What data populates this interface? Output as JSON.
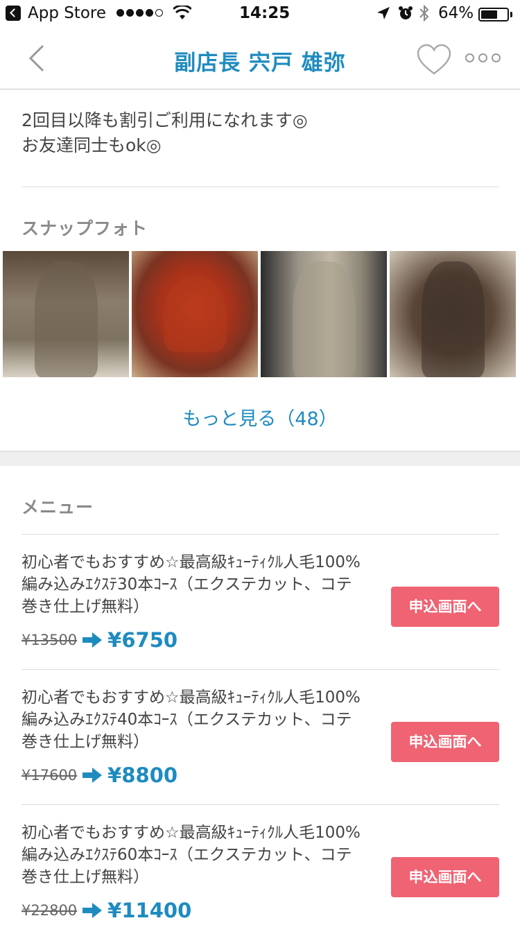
{
  "status_bar": {
    "back_app": "App Store",
    "time": "14:25",
    "battery": "64%",
    "battery_level": 0.64
  },
  "nav": {
    "title": "副店長 宍戸 雄弥"
  },
  "description": {
    "line1": "2回目以降も割引ご利用になれます◎",
    "line2": "お友達同士もok◎"
  },
  "snaps": {
    "heading": "スナップフォト",
    "more_label": "もっと見る（48）"
  },
  "menu": {
    "heading": "メニュー",
    "items": [
      {
        "line1": "初心者でもおすすめ☆最高級ｷｭｰﾃｨｸﾙ人毛100%",
        "line2": "編み込みｴｸｽﾃ30本ｺｰｽ（エクステカット、コテ",
        "line3": "巻き仕上げ無料）",
        "price_old": "¥13500",
        "price_new": "¥6750",
        "button": "申込画面へ"
      },
      {
        "line1": "初心者でもおすすめ☆最高級ｷｭｰﾃｨｸﾙ人毛100%",
        "line2": "編み込みｴｸｽﾃ40本ｺｰｽ（エクステカット、コテ",
        "line3": "巻き仕上げ無料）",
        "price_old": "¥17600",
        "price_new": "¥8800",
        "button": "申込画面へ"
      },
      {
        "line1": "初心者でもおすすめ☆最高級ｷｭｰﾃｨｸﾙ人毛100%",
        "line2": "編み込みｴｸｽﾃ60本ｺｰｽ（エクステカット、コテ",
        "line3": "巻き仕上げ無料）",
        "price_old": "¥22800",
        "price_new": "¥11400",
        "button": "申込画面へ"
      }
    ]
  },
  "colors": {
    "accent_blue": "#1e8bbf",
    "button_pink": "#ef6373"
  }
}
